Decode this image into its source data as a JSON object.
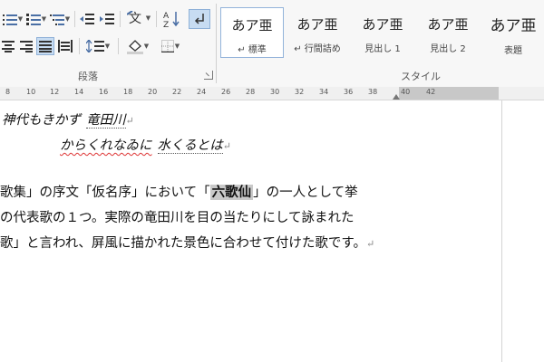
{
  "ribbon": {
    "paragraph_group_label": "段落",
    "styles_group_label": "スタイル",
    "styles": [
      {
        "sample": "あア亜",
        "name": "↵ 標準",
        "selected": true
      },
      {
        "sample": "あア亜",
        "name": "↵ 行間詰め",
        "selected": false
      },
      {
        "sample": "あア亜",
        "name": "見出し 1",
        "selected": false
      },
      {
        "sample": "あア亜",
        "name": "見出し 2",
        "selected": false
      },
      {
        "sample": "あア亜",
        "name": "表題",
        "selected": false
      }
    ],
    "icons": [
      "bullets-icon",
      "numbering-icon",
      "multilevel-list-icon",
      "decrease-indent-icon",
      "increase-indent-icon",
      "asian-layout-icon",
      "sort-icon",
      "show-marks-icon",
      "align-center-icon",
      "align-right-icon",
      "justify-icon",
      "distributed-icon",
      "line-spacing-icon",
      "shading-icon",
      "borders-icon"
    ]
  },
  "ruler": {
    "numbers": [
      "8",
      "10",
      "12",
      "14",
      "16",
      "18",
      "20",
      "22",
      "24",
      "26",
      "28",
      "30",
      "32",
      "34",
      "36",
      "38",
      "40",
      "42"
    ]
  },
  "document": {
    "poem_line1_a": "神代もきかず",
    "poem_line1_b": "竜田川",
    "poem_line2_a": "からくれなゐに",
    "poem_line2_b": "水くるとは",
    "para_line1_a": "歌集」の序文「仮名序」において「",
    "para_line1_hl": "六歌仙",
    "para_line1_b": "」の一人として挙",
    "para_line2": "の代表歌の１つ。実際の竜田川を目の当たりにして詠まれた",
    "para_line3": "歌」と言われ、屏風に描かれた景色に合わせて付けた歌です。",
    "paragraph_mark": "↵"
  }
}
